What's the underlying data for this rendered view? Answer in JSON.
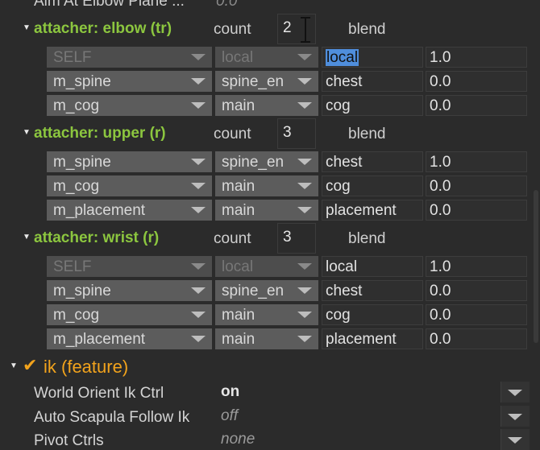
{
  "top_row": {
    "label": "Aim At Elbow Plane ...",
    "value": "0.0"
  },
  "sections": [
    {
      "title": "attacher: elbow (tr)",
      "count_label": "count",
      "count_value": "2",
      "blend_label": "blend",
      "rows": [
        {
          "a": "SELF",
          "b": "local",
          "c": "local",
          "d": "1.0",
          "disabled": true,
          "c_selected": true
        },
        {
          "a": "m_spine",
          "b": "spine_en",
          "c": "chest",
          "d": "0.0"
        },
        {
          "a": "m_cog",
          "b": "main",
          "c": "cog",
          "d": "0.0"
        }
      ]
    },
    {
      "title": "attacher: upper (r)",
      "count_label": "count",
      "count_value": "3",
      "blend_label": "blend",
      "rows": [
        {
          "a": "m_spine",
          "b": "spine_en",
          "c": "chest",
          "d": "1.0"
        },
        {
          "a": "m_cog",
          "b": "main",
          "c": "cog",
          "d": "0.0"
        },
        {
          "a": "m_placement",
          "b": "main",
          "c": "placement",
          "d": "0.0"
        }
      ]
    },
    {
      "title": "attacher: wrist (r)",
      "count_label": "count",
      "count_value": "3",
      "blend_label": "blend",
      "rows": [
        {
          "a": "SELF",
          "b": "local",
          "c": "local",
          "d": "1.0",
          "disabled": true
        },
        {
          "a": "m_spine",
          "b": "spine_en",
          "c": "chest",
          "d": "0.0"
        },
        {
          "a": "m_cog",
          "b": "main",
          "c": "cog",
          "d": "0.0"
        },
        {
          "a": "m_placement",
          "b": "main",
          "c": "placement",
          "d": "0.0"
        }
      ]
    }
  ],
  "ik": {
    "check_glyph": "✔",
    "title": "ik (feature)",
    "color": "#f2a31c",
    "props": [
      {
        "label": "World Orient Ik Ctrl",
        "value": "on",
        "style": "bold"
      },
      {
        "label": "Auto Scapula Follow Ik",
        "value": "off",
        "style": "italic"
      },
      {
        "label": "Pivot Ctrls",
        "value": "none",
        "style": "italic"
      }
    ]
  },
  "colors": {
    "section_title": "#8cc63f",
    "selection": "#4f8edc",
    "background": "#2b2b2b"
  }
}
